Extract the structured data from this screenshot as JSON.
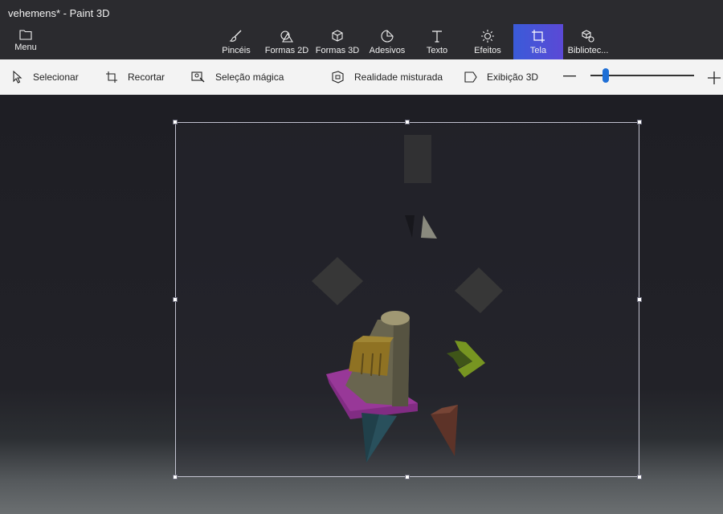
{
  "app": {
    "title": "vehemens* - Paint 3D"
  },
  "menu": {
    "label": "Menu",
    "icon": "folder-icon"
  },
  "tools": [
    {
      "id": "brushes",
      "label": "Pincéis",
      "icon": "brush-icon"
    },
    {
      "id": "shapes2d",
      "label": "Formas 2D",
      "icon": "shapes-2d-icon"
    },
    {
      "id": "shapes3d",
      "label": "Formas 3D",
      "icon": "cube-icon"
    },
    {
      "id": "stickers",
      "label": "Adesivos",
      "icon": "sticker-icon"
    },
    {
      "id": "text",
      "label": "Texto",
      "icon": "text-icon"
    },
    {
      "id": "effects",
      "label": "Efeitos",
      "icon": "sun-icon"
    },
    {
      "id": "canvas",
      "label": "Tela",
      "icon": "canvas-crop-icon",
      "active": true
    },
    {
      "id": "library",
      "label": "Bibliotec...",
      "icon": "library-icon"
    }
  ],
  "subtoolbar": {
    "select": "Selecionar",
    "crop": "Recortar",
    "magic_select": "Seleção mágica",
    "mixed_reality": "Realidade misturada",
    "view3d": "Exibição 3D"
  },
  "zoom": {
    "level": 0.15
  },
  "colors": {
    "accent": "#3a5bd8",
    "slider": "#1f6fd6"
  }
}
